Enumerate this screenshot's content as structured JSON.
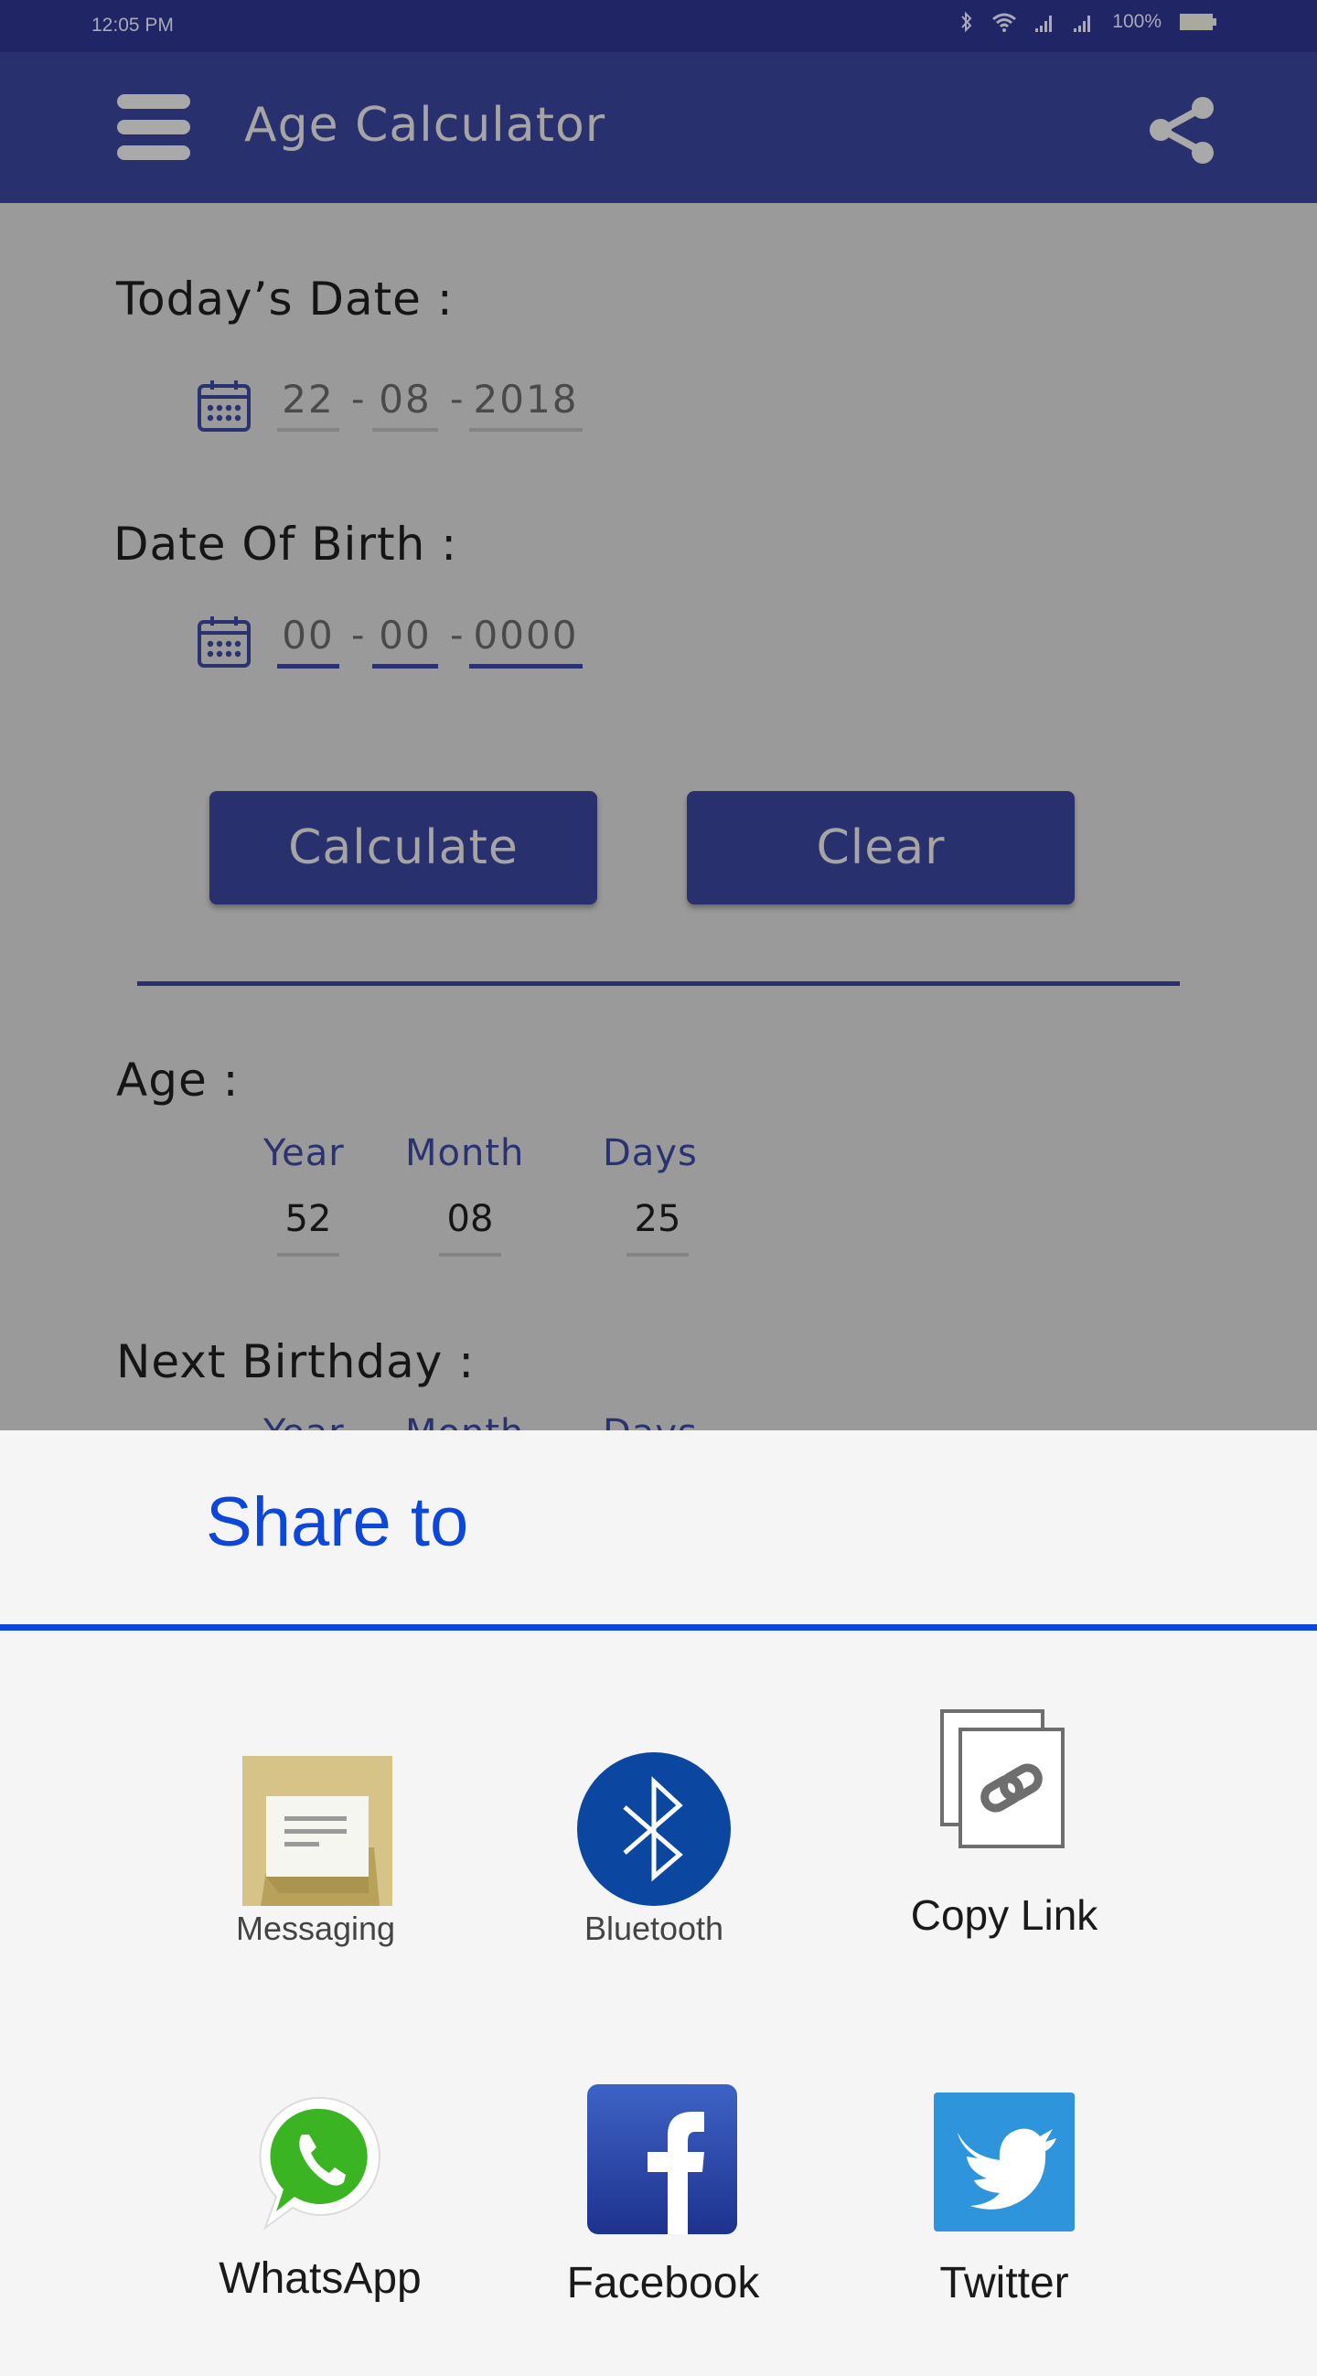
{
  "status_bar": {
    "time": "12:05 PM",
    "battery": "100%",
    "icons": [
      "bluetooth-icon",
      "wifi-icon",
      "signal-icon",
      "signal-icon",
      "battery-icon"
    ]
  },
  "app_bar": {
    "title": "Age Calculator",
    "menu_icon": "hamburger-menu-icon",
    "share_icon": "share-icon"
  },
  "todays_date": {
    "label": "Today’s Date :",
    "day": "22",
    "month": "08",
    "year": "2018",
    "separator": "-"
  },
  "date_of_birth": {
    "label": "Date Of Birth :",
    "day_placeholder": "00",
    "month_placeholder": "00",
    "year_placeholder": "0000",
    "separator": "-"
  },
  "buttons": {
    "calculate": "Calculate",
    "clear": "Clear"
  },
  "age": {
    "label": "Age :",
    "columns": [
      {
        "header": "Year",
        "value": "52"
      },
      {
        "header": "Month",
        "value": "08"
      },
      {
        "header": "Days",
        "value": "25"
      }
    ]
  },
  "next_birthday": {
    "label": "Next Birthday :",
    "columns": [
      {
        "header": "Year"
      },
      {
        "header": "Month"
      },
      {
        "header": "Days"
      }
    ]
  },
  "share_sheet": {
    "title": "Share to",
    "items": [
      {
        "label": "Messaging",
        "icon": "messaging-icon"
      },
      {
        "label": "Bluetooth",
        "icon": "bluetooth-icon"
      },
      {
        "label": "Copy Link",
        "icon": "copy-link-icon"
      },
      {
        "label": "WhatsApp",
        "icon": "whatsapp-icon"
      },
      {
        "label": "Facebook",
        "icon": "facebook-icon"
      },
      {
        "label": "Twitter",
        "icon": "twitter-icon"
      }
    ]
  },
  "colors": {
    "status_bar": "#1f2565",
    "app_bar": "#29306e",
    "accent": "#2a3270",
    "share_accent": "#0d47d9",
    "scrim_background": "#9a9a9a"
  }
}
